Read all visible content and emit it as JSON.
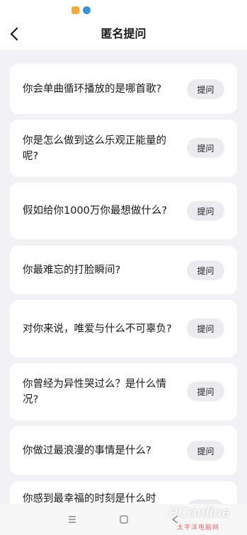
{
  "header": {
    "title": "匿名提问"
  },
  "questions": [
    {
      "text": "你会单曲循环播放的是哪首歌?",
      "button": "提问"
    },
    {
      "text": "你是怎么做到这么乐观正能量的呢?",
      "button": "提问"
    },
    {
      "text": "假如给你1000万你最想做什么?",
      "button": "提问"
    },
    {
      "text": "你最难忘的打脸瞬间?",
      "button": "提问"
    },
    {
      "text": "对你来说，唯爱与什么不可辜负?",
      "button": "提问"
    },
    {
      "text": "你曾经为异性哭过么？是什么情况?",
      "button": "提问"
    },
    {
      "text": "你做过最浪漫的事情是什么?",
      "button": "提问"
    },
    {
      "text": "你感到最幸福的时刻是什么时",
      "button": "提问"
    }
  ],
  "watermark": {
    "brand": "PConline",
    "tagline": "太平洋电脑网"
  },
  "icons": {
    "back": "chevron-left-icon",
    "menu": "menu-icon",
    "home": "home-icon",
    "system_back": "triangle-back-icon"
  }
}
